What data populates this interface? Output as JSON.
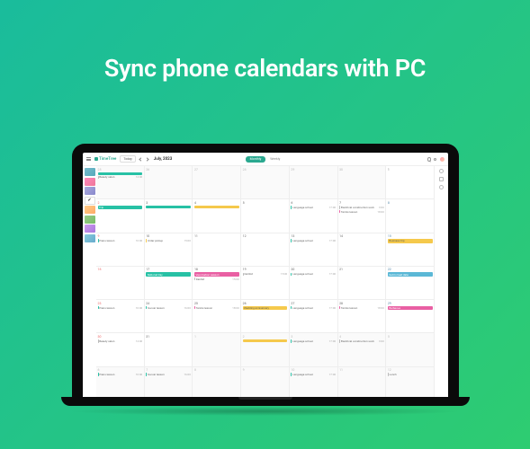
{
  "headline": "Sync phone calendars with PC",
  "app": {
    "logo": "TimeTree",
    "today": "Today",
    "month": "July, 2023",
    "views": {
      "monthly": "Monthly",
      "weekly": "Weekly"
    }
  },
  "weeks": [
    {
      "days": [
        {
          "n": "25",
          "grey": true,
          "chips": [
            {
              "cls": "green bar",
              "t": ""
            }
          ],
          "evt": [
            {
              "t": "Beauty salon",
              "c": "grey",
              "time": "14:00"
            }
          ]
        },
        {
          "n": "26",
          "grey": true
        },
        {
          "n": "27",
          "grey": true
        },
        {
          "n": "28",
          "grey": true
        },
        {
          "n": "29",
          "grey": true
        },
        {
          "n": "30",
          "grey": true
        },
        {
          "n": "1"
        }
      ]
    },
    {
      "days": [
        {
          "n": "2",
          "sun": true,
          "chips": [
            {
              "cls": "green",
              "t": "Trip"
            }
          ]
        },
        {
          "n": "3",
          "chips": [
            {
              "cls": "green bar",
              "t": ""
            }
          ]
        },
        {
          "n": "4",
          "chips": [
            {
              "cls": "yellow bar",
              "t": ""
            }
          ]
        },
        {
          "n": "5"
        },
        {
          "n": "6",
          "evt": [
            {
              "t": "Language school",
              "c": "green",
              "time": "17:00"
            }
          ]
        },
        {
          "n": "7",
          "evt": [
            {
              "t": "Electrical construction work",
              "c": "grey",
              "time": "9:00"
            },
            {
              "t": "Tennis lesson",
              "c": "pink",
              "time": "18:00"
            }
          ]
        },
        {
          "n": "8",
          "sat": true
        }
      ]
    },
    {
      "days": [
        {
          "n": "9",
          "sun": true,
          "evt": [
            {
              "t": "Piano lesson",
              "c": "green",
              "time": "10:00"
            }
          ]
        },
        {
          "n": "10",
          "evt": [
            {
              "t": "Order pickup",
              "c": "yellow",
              "time": "15:00"
            }
          ]
        },
        {
          "n": "11"
        },
        {
          "n": "12"
        },
        {
          "n": "13",
          "evt": [
            {
              "t": "Language school",
              "c": "green",
              "time": "17:00"
            }
          ]
        },
        {
          "n": "14"
        },
        {
          "n": "15",
          "sat": true,
          "chips": [
            {
              "cls": "yellow",
              "t": "Business trip"
            }
          ]
        }
      ]
    },
    {
      "days": [
        {
          "n": "16",
          "sun": true
        },
        {
          "n": "17",
          "chips": [
            {
              "cls": "green",
              "t": "National Day"
            }
          ]
        },
        {
          "n": "18",
          "chips": [
            {
              "cls": "pink",
              "t": "Vaccination season"
            }
          ],
          "evt": [
            {
              "t": "Dentist",
              "c": "grey",
              "time": "15:00"
            }
          ]
        },
        {
          "n": "19",
          "evt": [
            {
              "t": "Dentist",
              "c": "grey",
              "time": "15:00"
            }
          ]
        },
        {
          "n": "20",
          "evt": [
            {
              "t": "Language school",
              "c": "green",
              "time": "17:00"
            }
          ]
        },
        {
          "n": "21"
        },
        {
          "n": "22",
          "sat": true,
          "chips": [
            {
              "cls": "blue",
              "t": "Swim meet date"
            }
          ]
        }
      ]
    },
    {
      "days": [
        {
          "n": "23",
          "sun": true,
          "evt": [
            {
              "t": "Piano lesson",
              "c": "green",
              "time": "10:00"
            }
          ]
        },
        {
          "n": "24",
          "evt": [
            {
              "t": "Soccer lesson",
              "c": "green",
              "time": "16:00"
            }
          ]
        },
        {
          "n": "25",
          "evt": [
            {
              "t": "Tennis lesson",
              "c": "pink",
              "time": "18:00"
            }
          ]
        },
        {
          "n": "26",
          "chips": [
            {
              "cls": "yellow",
              "t": "Wedding anniversary"
            }
          ]
        },
        {
          "n": "27",
          "evt": [
            {
              "t": "Language school",
              "c": "green",
              "time": "17:00"
            }
          ]
        },
        {
          "n": "28",
          "evt": [
            {
              "t": "Tennis lesson",
              "c": "pink",
              "time": "18:00"
            }
          ]
        },
        {
          "n": "29",
          "sat": true,
          "chips": [
            {
              "cls": "pink",
              "t": "Barbecue"
            }
          ]
        }
      ]
    },
    {
      "days": [
        {
          "n": "30",
          "sun": true,
          "evt": [
            {
              "t": "Beauty salon",
              "c": "grey",
              "time": "14:00"
            }
          ]
        },
        {
          "n": "31"
        },
        {
          "n": "1",
          "grey": true
        },
        {
          "n": "2",
          "grey": true,
          "chips": [
            {
              "cls": "yellow bar",
              "t": ""
            }
          ]
        },
        {
          "n": "3",
          "grey": true,
          "evt": [
            {
              "t": "Language school",
              "c": "green",
              "time": "17:00"
            }
          ]
        },
        {
          "n": "4",
          "grey": true,
          "evt": [
            {
              "t": "Electrical construction work",
              "c": "grey",
              "time": "9:00"
            }
          ]
        },
        {
          "n": "5",
          "grey": true
        }
      ]
    },
    {
      "days": [
        {
          "n": "6",
          "grey": true,
          "evt": [
            {
              "t": "Piano lesson",
              "c": "green",
              "time": "10:00"
            }
          ]
        },
        {
          "n": "7",
          "grey": true,
          "evt": [
            {
              "t": "Soccer lesson",
              "c": "green",
              "time": "16:00"
            }
          ]
        },
        {
          "n": "8",
          "grey": true
        },
        {
          "n": "9",
          "grey": true
        },
        {
          "n": "10",
          "grey": true,
          "evt": [
            {
              "t": "Language school",
              "c": "green",
              "time": "17:00"
            }
          ]
        },
        {
          "n": "11",
          "grey": true
        },
        {
          "n": "12",
          "grey": true,
          "evt": [
            {
              "t": "Lunch",
              "c": "grey",
              "time": ""
            }
          ]
        }
      ]
    }
  ]
}
